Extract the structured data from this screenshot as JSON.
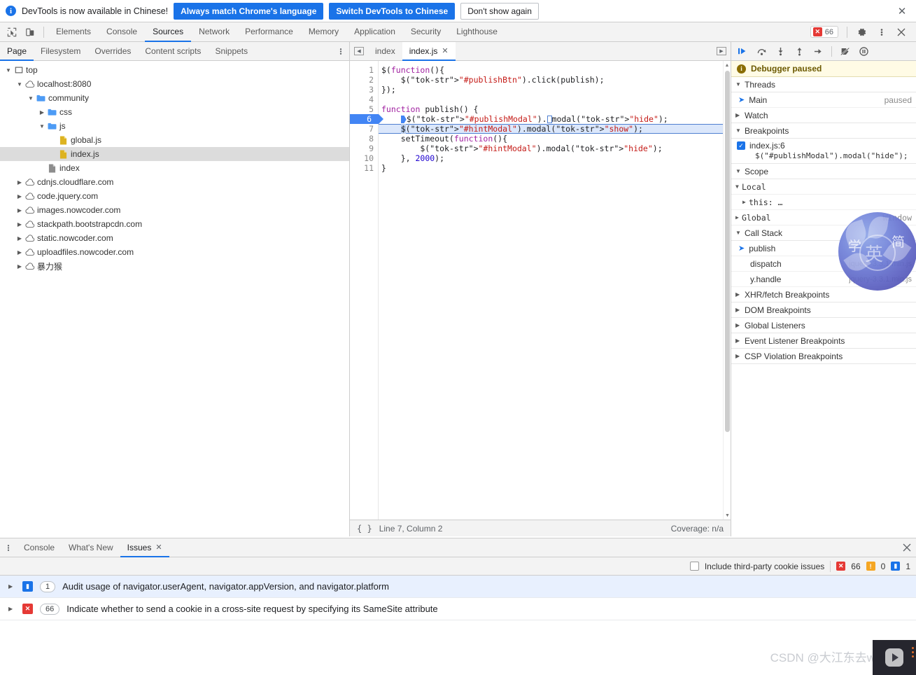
{
  "notification": {
    "icon": "info-icon",
    "message": "DevTools is now available in Chinese!",
    "primary_button": "Always match Chrome's language",
    "secondary_button": "Switch DevTools to Chinese",
    "tertiary_button": "Don't show again",
    "close": "✕"
  },
  "toolbar": {
    "inspect_icon": "inspect-element-icon",
    "device_icon": "device-toolbar-icon",
    "tabs": [
      {
        "label": "Elements",
        "active": false
      },
      {
        "label": "Console",
        "active": false
      },
      {
        "label": "Sources",
        "active": true
      },
      {
        "label": "Network",
        "active": false
      },
      {
        "label": "Performance",
        "active": false
      },
      {
        "label": "Memory",
        "active": false
      },
      {
        "label": "Application",
        "active": false
      },
      {
        "label": "Security",
        "active": false
      },
      {
        "label": "Lighthouse",
        "active": false
      }
    ],
    "error_count": "66",
    "settings_icon": "gear-icon",
    "more_icon": "kebab-menu-icon",
    "close_icon": "close-icon"
  },
  "navigator": {
    "tabs": [
      {
        "label": "Page",
        "active": true
      },
      {
        "label": "Filesystem",
        "active": false
      },
      {
        "label": "Overrides",
        "active": false
      },
      {
        "label": "Content scripts",
        "active": false
      },
      {
        "label": "Snippets",
        "active": false
      }
    ],
    "more_icon": "kebab-menu-icon",
    "tree": [
      {
        "label": "top",
        "indent": 0,
        "twisty": "open",
        "icon": "frame-icon",
        "selected": false
      },
      {
        "label": "localhost:8080",
        "indent": 1,
        "twisty": "open",
        "icon": "cloud-icon",
        "selected": false
      },
      {
        "label": "community",
        "indent": 2,
        "twisty": "open",
        "icon": "folder-icon",
        "selected": false
      },
      {
        "label": "css",
        "indent": 3,
        "twisty": "closed",
        "icon": "folder-icon",
        "selected": false
      },
      {
        "label": "js",
        "indent": 3,
        "twisty": "open",
        "icon": "folder-icon",
        "selected": false
      },
      {
        "label": "global.js",
        "indent": 4,
        "twisty": "none",
        "icon": "js-file-icon",
        "selected": false
      },
      {
        "label": "index.js",
        "indent": 4,
        "twisty": "none",
        "icon": "js-file-icon",
        "selected": true
      },
      {
        "label": "index",
        "indent": 3,
        "twisty": "none",
        "icon": "document-file-icon",
        "selected": false
      },
      {
        "label": "cdnjs.cloudflare.com",
        "indent": 1,
        "twisty": "closed",
        "icon": "cloud-icon",
        "selected": false
      },
      {
        "label": "code.jquery.com",
        "indent": 1,
        "twisty": "closed",
        "icon": "cloud-icon",
        "selected": false
      },
      {
        "label": "images.nowcoder.com",
        "indent": 1,
        "twisty": "closed",
        "icon": "cloud-icon",
        "selected": false
      },
      {
        "label": "stackpath.bootstrapcdn.com",
        "indent": 1,
        "twisty": "closed",
        "icon": "cloud-icon",
        "selected": false
      },
      {
        "label": "static.nowcoder.com",
        "indent": 1,
        "twisty": "closed",
        "icon": "cloud-icon",
        "selected": false
      },
      {
        "label": "uploadfiles.nowcoder.com",
        "indent": 1,
        "twisty": "closed",
        "icon": "cloud-icon",
        "selected": false
      },
      {
        "label": "暴力猴",
        "indent": 1,
        "twisty": "closed",
        "icon": "cloud-icon",
        "selected": false
      }
    ]
  },
  "editor": {
    "scroll_left_icon": "scroll-tabs-left-icon",
    "scroll_right_icon": "scroll-tabs-right-icon",
    "tabs": [
      {
        "label": "index",
        "active": false,
        "closable": false
      },
      {
        "label": "index.js",
        "active": true,
        "closable": true
      }
    ],
    "close_glyph": "✕",
    "line_numbers": [
      "1",
      "2",
      "3",
      "4",
      "5",
      "6",
      "7",
      "8",
      "9",
      "10",
      "11"
    ],
    "breakpoint_line": 6,
    "execution_line": 7,
    "code_lines": [
      "$(function(){",
      "    $(\"#publishBtn\").click(publish);",
      "});",
      "",
      "function publish() {",
      "    $(\"#publishModal\").modal(\"hide\");",
      "    $(\"#hintModal\").modal(\"show\");",
      "    setTimeout(function(){",
      "        $(\"#hintModal\").modal(\"hide\");",
      "    }, 2000);",
      "}"
    ],
    "status": {
      "format_icon": "pretty-print-braces-icon",
      "position": "Line 7, Column 2",
      "coverage": "Coverage: n/a"
    }
  },
  "debugger": {
    "toolbar": [
      {
        "name": "resume-script-execution-icon",
        "title": "Resume"
      },
      {
        "name": "step-over-icon",
        "title": "Step over"
      },
      {
        "name": "step-into-icon",
        "title": "Step into"
      },
      {
        "name": "step-out-icon",
        "title": "Step out"
      },
      {
        "name": "step-icon",
        "title": "Step"
      },
      {
        "name": "deactivate-breakpoints-icon",
        "title": "Deactivate breakpoints"
      },
      {
        "name": "pause-on-exceptions-icon",
        "title": "Pause on exceptions"
      }
    ],
    "paused_banner": "Debugger paused",
    "sections": {
      "threads": {
        "label": "Threads",
        "expanded": true,
        "rows": [
          {
            "name": "Main",
            "state": "paused",
            "current": true
          }
        ]
      },
      "watch": {
        "label": "Watch",
        "expanded": false
      },
      "breakpoints": {
        "label": "Breakpoints",
        "expanded": true,
        "items": [
          {
            "checked": true,
            "location": "index.js:6",
            "code": "$(\"#publishModal\").modal(\"hide\");"
          }
        ]
      },
      "scope": {
        "label": "Scope",
        "expanded": true,
        "rows": [
          {
            "label": "Local",
            "indent": 0,
            "twisty": "open"
          },
          {
            "label": "this: …",
            "indent": 1,
            "twisty": "closed"
          },
          {
            "label": "Global",
            "indent": 0,
            "twisty": "closed",
            "value": "Window"
          }
        ]
      },
      "call_stack": {
        "label": "Call Stack",
        "expanded": true,
        "frames": [
          {
            "fn": "publish",
            "loc": "",
            "current": true
          },
          {
            "fn": "dispatch",
            "loc": "jquery-3.3.1.min.js",
            "current": false
          },
          {
            "fn": "y.handle",
            "loc": "jquery-3.3.1.min.js",
            "current": false
          }
        ]
      },
      "collapsed": [
        {
          "label": "XHR/fetch Breakpoints"
        },
        {
          "label": "DOM Breakpoints"
        },
        {
          "label": "Global Listeners"
        },
        {
          "label": "Event Listener Breakpoints"
        },
        {
          "label": "CSP Violation Breakpoints"
        }
      ]
    }
  },
  "drawer": {
    "more_icon": "kebab-menu-icon",
    "tabs": [
      {
        "label": "Console",
        "active": false,
        "closable": false
      },
      {
        "label": "What's New",
        "active": false,
        "closable": false
      },
      {
        "label": "Issues",
        "active": true,
        "closable": true
      }
    ],
    "close_glyph": "✕",
    "close_drawer_icon": "close-icon",
    "filter_bar": {
      "checkbox_label": "Include third-party cookie issues",
      "checked": false,
      "error_count": "66",
      "warning_count": "0",
      "info_count": "1"
    },
    "issues": [
      {
        "severity": "info",
        "count": "1",
        "text": "Audit usage of navigator.userAgent, navigator.appVersion, and navigator.platform",
        "highlighted": true
      },
      {
        "severity": "error",
        "count": "66",
        "text": "Indicate whether to send a cookie in a cross-site request by specifying its SameSite attribute",
        "highlighted": false
      }
    ]
  },
  "watermarks": {
    "csdn": "CSDN @大江东去wsh",
    "circle_chars": [
      "学",
      "简",
      "英"
    ],
    "video_play_icon": "play-button-icon"
  },
  "colors": {
    "accent": "#1a73e8",
    "error": "#e53935",
    "warning": "#f5a623",
    "breakpoint": "#4285f4",
    "exec_line_bg": "#dbe7fb",
    "paused_bg": "#fffbe5",
    "toolbar_bg": "#f3f3f3",
    "selected_bg": "#dcdcdc",
    "string_token": "#c41a16",
    "keyword_token": "#a020a0",
    "number_token": "#1c00cf"
  }
}
